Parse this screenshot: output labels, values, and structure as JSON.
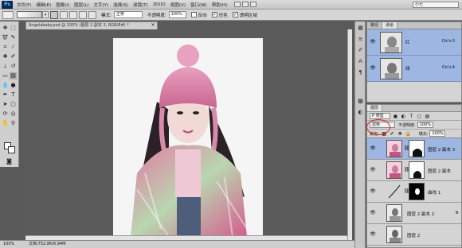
{
  "app": {
    "logo": "Ps",
    "menus": [
      "文件(F)",
      "编辑(E)",
      "图像(I)",
      "图层(L)",
      "文字(Y)",
      "选择(S)",
      "滤镜(T)",
      "3D(D)",
      "视图(V)",
      "窗口(W)",
      "帮助(H)"
    ],
    "workspace": "小七"
  },
  "options": {
    "mode_label": "模式:",
    "mode_value": "正常",
    "opacity_label": "不透明度:",
    "opacity_value": "100%",
    "reverse_label": "反向",
    "dither_label": "仿色",
    "transparency_label": "透明区域"
  },
  "document": {
    "tab_title": "Angelababy.psd @ 100% (图层 2 副本 3, RGB/8#) *",
    "status_zoom": "100%",
    "status_doc": "文档:752.8K/6.94M"
  },
  "channels": {
    "tabs": [
      "路径",
      "通道"
    ],
    "rows": [
      {
        "name": "红",
        "shortcut": "Ctrl+3"
      },
      {
        "name": "绿",
        "shortcut": "Ctrl+4"
      }
    ]
  },
  "layers": {
    "tab": "图层",
    "kind_label": "P 类型",
    "blend_value": "滤色",
    "opacity_label": "不透明度:",
    "opacity_value": "100%",
    "lock_label": "锁定:",
    "fill_label": "填充:",
    "fill_value": "100%",
    "items": [
      {
        "name": "图层 2 副本 3",
        "active": true
      },
      {
        "name": "图层 2 副本"
      },
      {
        "name": "曲线 1"
      },
      {
        "name": "图层 2 副本 2"
      },
      {
        "name": "图层 2"
      }
    ]
  },
  "colors": {
    "selection": "#9eb6e2",
    "annotation": "#e02020"
  }
}
